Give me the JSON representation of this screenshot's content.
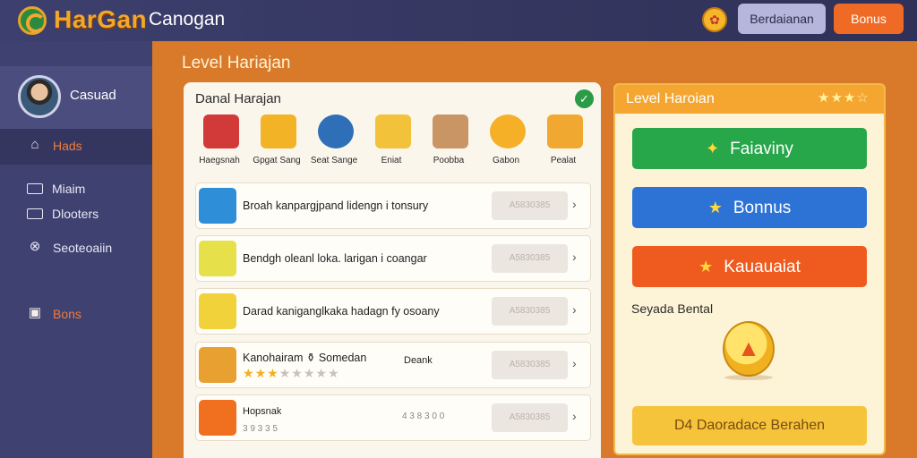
{
  "topbar": {
    "brand": "HarGan",
    "title": "Canogan",
    "button1": "Berdaianan",
    "button2": "Bonus"
  },
  "sidebar": {
    "profile_name": "Casuad",
    "items": [
      {
        "label": "Hads",
        "icon": "home-icon"
      },
      {
        "label": "Miaim",
        "icon": "inbox-icon"
      },
      {
        "label": "Dlooters",
        "icon": "card-icon"
      },
      {
        "label": "Seoteoaiin",
        "icon": "close-circle-icon"
      },
      {
        "label": "Bons",
        "icon": "store-icon"
      }
    ]
  },
  "main": {
    "title": "Level Hariajan",
    "panel_title": "Danal Harajan",
    "categories": [
      {
        "label": "Haegsnah",
        "color": "#d23a3a"
      },
      {
        "label": "Gpgat Sang",
        "color": "#f2b326"
      },
      {
        "label": "Seat Sange",
        "color": "#2e6fb8"
      },
      {
        "label": "Eniat",
        "color": "#f2c23a"
      },
      {
        "label": "Poobba",
        "color": "#c99565"
      },
      {
        "label": "Gabon",
        "color": "#f5b027"
      },
      {
        "label": "Pealat",
        "color": "#f0a830"
      }
    ],
    "rows": [
      {
        "text": "Broah kanpargjpand lidengn i tonsury",
        "button": "A5830385",
        "icon_color": "#2e8fd8"
      },
      {
        "text": "Bendgh oleanl loka. larigan i coangar",
        "button": "A5830385",
        "icon_color": "#e6e04a"
      },
      {
        "text": "Darad kaniganglkaka hadagn fy osoany",
        "button": "A5830385",
        "icon_color": "#f2d23a"
      },
      {
        "text": "Kanohairam",
        "sub_text": "Somedan",
        "extra": "Deank",
        "button": "A5830385",
        "icon_color": "#e8a030",
        "stars_on": 3,
        "stars_total": 8
      },
      {
        "text": "Hopsnak",
        "sub_text": "3 9 3 3 5",
        "price": "4 3 8 3 0 0",
        "button": "A5830385",
        "icon_color": "#f07020"
      }
    ]
  },
  "right_card": {
    "title": "Level Haroian",
    "btn1": "Faiaviny",
    "btn2": "Bonnus",
    "btn3": "Kauauaiat",
    "label": "Seyada Bental",
    "bottom": "D4 Daoradace Berahen",
    "colors": {
      "btn1": "#27a64a",
      "btn2": "#2d73d6",
      "btn3": "#ef5a1e",
      "bottom": "#f5c43a"
    }
  }
}
